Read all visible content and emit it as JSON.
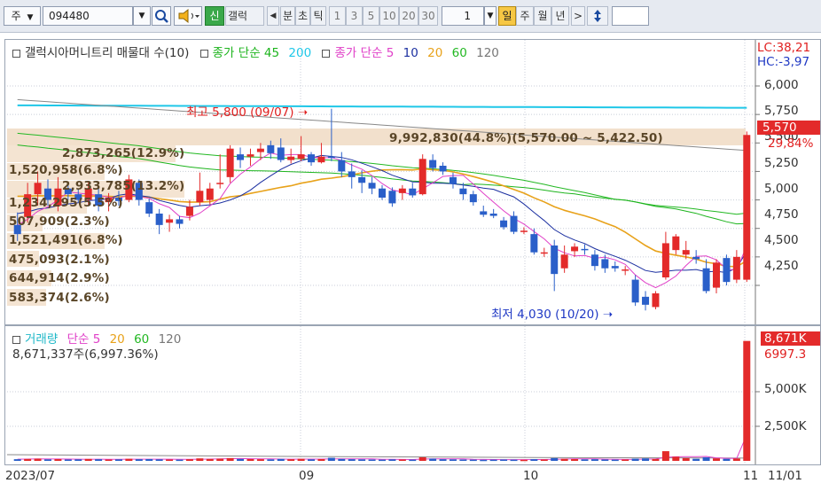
{
  "toolbar": {
    "type_select": "주",
    "code_input": "094480",
    "name_tag": "신",
    "name_label": "갤럭",
    "period_labels": [
      "분",
      "초",
      "틱"
    ],
    "interval_buttons": [
      "1",
      "3",
      "5",
      "10",
      "20",
      "30"
    ],
    "interval_value": "1",
    "daily": "일",
    "weekly": "주",
    "monthly": "월",
    "yearly": "년",
    "next_arrow": ">"
  },
  "price_panel": {
    "legend": {
      "stock_name": "갤럭시아머니트리 매물대 수(10)",
      "ma_long_label": "종가 단순",
      "ma_long_periods": [
        "45",
        "200"
      ],
      "ma_short_label": "종가 단순",
      "ma_short_periods": [
        "5",
        "10",
        "20",
        "60",
        "120"
      ]
    },
    "y_axis_ticks": [
      "6,000",
      "5,750",
      "5,500",
      "5,250",
      "5,000",
      "4,750",
      "4,500",
      "4,250"
    ],
    "right_labels": {
      "lc": "LC:38,21",
      "hc": "HC:-3,97",
      "last_price": "5,570",
      "change": "29,84%"
    },
    "high_annotation": "최고 5,800 (09/07)",
    "low_annotation": "최저 4,030 (10/20)",
    "volume_profile": [
      "2,873,265(12.9%)",
      "1,520,958(6.8%)",
      "2,933,785(13.2%)",
      "1,234,295(5.5%)",
      "507,909(2.3%)",
      "1,521,491(6.8%)",
      "475,093(2.1%)",
      "644,914(2.9%)",
      "583,374(2.6%)"
    ],
    "max_profile": "9,992,830(44.8%)(5,570.00 ~ 5,422.50)",
    "colors": {
      "up": "#e32a2a",
      "down": "#2a5fc9",
      "ma5": "#e040c8",
      "ma10": "#1b2fa0",
      "ma20": "#e8a21a",
      "ma60": "#22b822",
      "ma120": "#888888",
      "ma45": "#1db41d",
      "ma200": "#1fc7e8"
    }
  },
  "volume_panel": {
    "legend": {
      "title": "거래량",
      "ma_label": "단순",
      "periods": [
        "5",
        "20",
        "60",
        "120"
      ]
    },
    "summary": "8,671,337주(6,997.36%)",
    "y_axis_ticks": [
      "5,000K",
      "2,500K"
    ],
    "right_labels": {
      "last_volume": "8,671K",
      "ratio": "6997.3"
    }
  },
  "date_axis": {
    "labels": [
      "2023/07",
      "09",
      "10",
      "11",
      "11/01"
    ]
  },
  "chart_data": {
    "type": "candlestick",
    "title": "갤럭시아머니트리 매물대 수(10)",
    "ylim": [
      4000,
      6120
    ],
    "x_labels": [
      "2023/07",
      "09",
      "10",
      "11",
      "11/01"
    ],
    "candles": [
      {
        "o": 4780,
        "h": 4890,
        "l": 4640,
        "c": 4700
      },
      {
        "o": 4850,
        "h": 5150,
        "l": 4800,
        "c": 5050
      },
      {
        "o": 5050,
        "h": 5250,
        "l": 4950,
        "c": 5150
      },
      {
        "o": 5100,
        "h": 5180,
        "l": 4950,
        "c": 5000
      },
      {
        "o": 4950,
        "h": 5200,
        "l": 4900,
        "c": 5100
      },
      {
        "o": 5100,
        "h": 5150,
        "l": 5000,
        "c": 5050
      },
      {
        "o": 5050,
        "h": 5100,
        "l": 4980,
        "c": 5000
      },
      {
        "o": 5000,
        "h": 5150,
        "l": 4950,
        "c": 5100
      },
      {
        "o": 5050,
        "h": 5120,
        "l": 4900,
        "c": 4950
      },
      {
        "o": 4980,
        "h": 5060,
        "l": 4900,
        "c": 5020
      },
      {
        "o": 5020,
        "h": 5080,
        "l": 4950,
        "c": 4990
      },
      {
        "o": 5000,
        "h": 5220,
        "l": 4980,
        "c": 5180
      },
      {
        "o": 5150,
        "h": 5180,
        "l": 4950,
        "c": 5000
      },
      {
        "o": 4980,
        "h": 5010,
        "l": 4850,
        "c": 4880
      },
      {
        "o": 4880,
        "h": 4920,
        "l": 4700,
        "c": 4780
      },
      {
        "o": 4800,
        "h": 4870,
        "l": 4720,
        "c": 4830
      },
      {
        "o": 4830,
        "h": 4860,
        "l": 4750,
        "c": 4790
      },
      {
        "o": 4860,
        "h": 5000,
        "l": 4820,
        "c": 4940
      },
      {
        "o": 4980,
        "h": 5240,
        "l": 4950,
        "c": 5080
      },
      {
        "o": 5000,
        "h": 5150,
        "l": 4960,
        "c": 5100
      },
      {
        "o": 5150,
        "h": 5400,
        "l": 5100,
        "c": 5150
      },
      {
        "o": 5200,
        "h": 5480,
        "l": 5150,
        "c": 5450
      },
      {
        "o": 5400,
        "h": 5460,
        "l": 5280,
        "c": 5350
      },
      {
        "o": 5380,
        "h": 5450,
        "l": 5300,
        "c": 5400
      },
      {
        "o": 5420,
        "h": 5500,
        "l": 5350,
        "c": 5450
      },
      {
        "o": 5480,
        "h": 5520,
        "l": 5360,
        "c": 5410
      },
      {
        "o": 5460,
        "h": 5540,
        "l": 5330,
        "c": 5350
      },
      {
        "o": 5350,
        "h": 5450,
        "l": 5320,
        "c": 5380
      },
      {
        "o": 5360,
        "h": 5560,
        "l": 5340,
        "c": 5400
      },
      {
        "o": 5400,
        "h": 5420,
        "l": 5300,
        "c": 5330
      },
      {
        "o": 5330,
        "h": 5500,
        "l": 5320,
        "c": 5380
      },
      {
        "o": 5380,
        "h": 5800,
        "l": 5340,
        "c": 5370
      },
      {
        "o": 5350,
        "h": 5420,
        "l": 5200,
        "c": 5250
      },
      {
        "o": 5250,
        "h": 5320,
        "l": 5100,
        "c": 5200
      },
      {
        "o": 5200,
        "h": 5260,
        "l": 5060,
        "c": 5150
      },
      {
        "o": 5150,
        "h": 5200,
        "l": 5050,
        "c": 5100
      },
      {
        "o": 5100,
        "h": 5130,
        "l": 5000,
        "c": 5020
      },
      {
        "o": 5080,
        "h": 5110,
        "l": 4940,
        "c": 4970
      },
      {
        "o": 5060,
        "h": 5130,
        "l": 5000,
        "c": 5100
      },
      {
        "o": 5100,
        "h": 5150,
        "l": 5020,
        "c": 5040
      },
      {
        "o": 5050,
        "h": 5400,
        "l": 5040,
        "c": 5360
      },
      {
        "o": 5350,
        "h": 5400,
        "l": 5250,
        "c": 5280
      },
      {
        "o": 5300,
        "h": 5330,
        "l": 5220,
        "c": 5250
      },
      {
        "o": 5200,
        "h": 5240,
        "l": 5100,
        "c": 5140
      },
      {
        "o": 5100,
        "h": 5150,
        "l": 5000,
        "c": 5050
      },
      {
        "o": 5050,
        "h": 5080,
        "l": 4950,
        "c": 4980
      },
      {
        "o": 4900,
        "h": 4950,
        "l": 4850,
        "c": 4870
      },
      {
        "o": 4880,
        "h": 4920,
        "l": 4840,
        "c": 4860
      },
      {
        "o": 4820,
        "h": 4850,
        "l": 4740,
        "c": 4760
      },
      {
        "o": 4860,
        "h": 4900,
        "l": 4700,
        "c": 4720
      },
      {
        "o": 4720,
        "h": 4760,
        "l": 4700,
        "c": 4730
      },
      {
        "o": 4700,
        "h": 4750,
        "l": 4520,
        "c": 4540
      },
      {
        "o": 4540,
        "h": 4580,
        "l": 4500,
        "c": 4540
      },
      {
        "o": 4600,
        "h": 4650,
        "l": 4200,
        "c": 4350
      },
      {
        "o": 4400,
        "h": 4600,
        "l": 4360,
        "c": 4520
      },
      {
        "o": 4550,
        "h": 4620,
        "l": 4500,
        "c": 4590
      },
      {
        "o": 4570,
        "h": 4610,
        "l": 4520,
        "c": 4560
      },
      {
        "o": 4520,
        "h": 4560,
        "l": 4380,
        "c": 4420
      },
      {
        "o": 4480,
        "h": 4520,
        "l": 4360,
        "c": 4400
      },
      {
        "o": 4420,
        "h": 4460,
        "l": 4370,
        "c": 4400
      },
      {
        "o": 4380,
        "h": 4420,
        "l": 4340,
        "c": 4390
      },
      {
        "o": 4300,
        "h": 4340,
        "l": 4070,
        "c": 4100
      },
      {
        "o": 4150,
        "h": 4200,
        "l": 4030,
        "c": 4080
      },
      {
        "o": 4060,
        "h": 4200,
        "l": 4040,
        "c": 4180
      },
      {
        "o": 4320,
        "h": 4720,
        "l": 4300,
        "c": 4620
      },
      {
        "o": 4560,
        "h": 4700,
        "l": 4520,
        "c": 4680
      },
      {
        "o": 4520,
        "h": 4640,
        "l": 4480,
        "c": 4560
      },
      {
        "o": 4500,
        "h": 4560,
        "l": 4440,
        "c": 4480
      },
      {
        "o": 4400,
        "h": 4480,
        "l": 4180,
        "c": 4200
      },
      {
        "o": 4230,
        "h": 4480,
        "l": 4180,
        "c": 4450
      },
      {
        "o": 4490,
        "h": 4520,
        "l": 4250,
        "c": 4280
      },
      {
        "o": 4300,
        "h": 4560,
        "l": 4270,
        "c": 4500
      },
      {
        "o": 4300,
        "h": 5600,
        "l": 4280,
        "c": 5570
      }
    ],
    "volume": [
      120,
      140,
      160,
      110,
      130,
      100,
      110,
      140,
      120,
      100,
      110,
      150,
      120,
      130,
      110,
      100,
      90,
      120,
      180,
      140,
      160,
      200,
      140,
      130,
      120,
      110,
      140,
      120,
      150,
      110,
      130,
      220,
      140,
      120,
      110,
      100,
      90,
      110,
      100,
      90,
      260,
      160,
      120,
      110,
      100,
      90,
      80,
      90,
      100,
      90,
      80,
      120,
      100,
      200,
      150,
      130,
      110,
      120,
      100,
      90,
      100,
      160,
      180,
      140,
      700,
      300,
      200,
      150,
      260,
      180,
      150,
      170,
      8671
    ]
  }
}
